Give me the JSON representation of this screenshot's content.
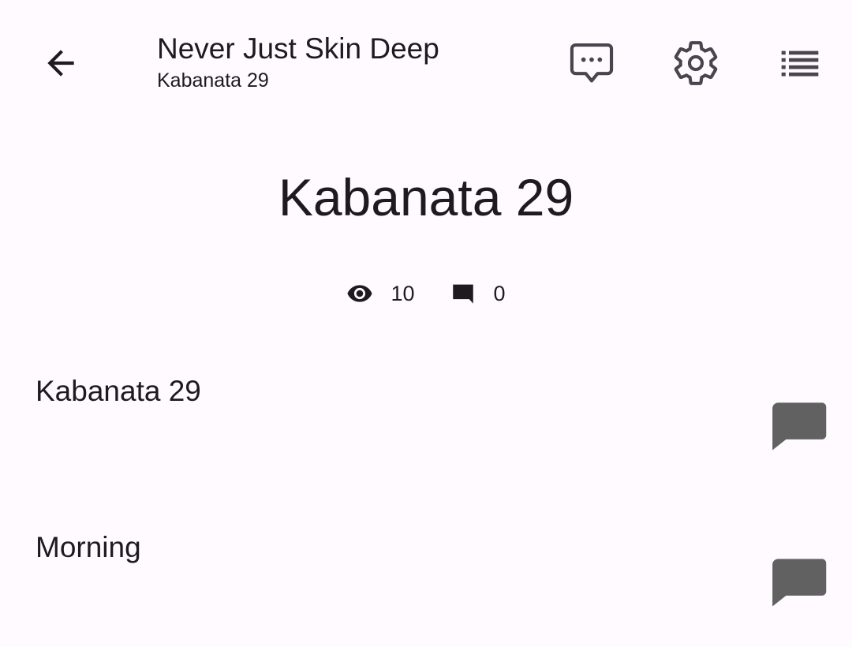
{
  "header": {
    "title": "Never Just Skin Deep",
    "subtitle": "Kabanata 29",
    "icons": [
      "arrow-back-icon",
      "chat-bubble-ellipsis-icon",
      "gear-icon",
      "list-icon"
    ]
  },
  "chapter": {
    "title": "Kabanata 29",
    "views": "10",
    "comments": "0"
  },
  "paragraphs": [
    {
      "text": "Kabanata 29",
      "icon": "comment-icon"
    },
    {
      "text": "Morning",
      "icon": "comment-icon"
    }
  ],
  "colors": {
    "background": "#fefaff",
    "text": "#1d1b1f",
    "toolbar_icon": "#49454f",
    "comment_button": "#616161"
  }
}
